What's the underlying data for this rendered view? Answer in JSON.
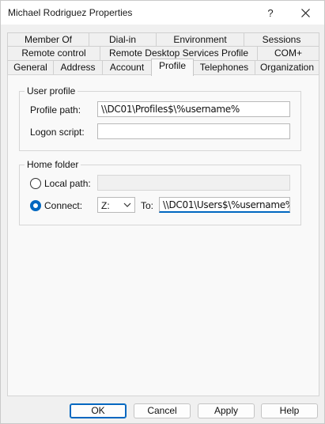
{
  "window": {
    "title": "Michael Rodriguez Properties",
    "help_label": "?",
    "close_label": "✕"
  },
  "tabs": {
    "row1": [
      "Member Of",
      "Dial-in",
      "Environment",
      "Sessions"
    ],
    "row2": [
      "Remote control",
      "Remote Desktop Services Profile",
      "COM+"
    ],
    "row3": [
      "General",
      "Address",
      "Account",
      "Profile",
      "Telephones",
      "Organization"
    ],
    "active": "Profile"
  },
  "user_profile": {
    "group_label": "User profile",
    "profile_path_label": "Profile path:",
    "profile_path_value": "\\\\DC01\\Profiles$\\%username%",
    "logon_script_label": "Logon script:",
    "logon_script_value": ""
  },
  "home_folder": {
    "group_label": "Home folder",
    "local_path_label": "Local path:",
    "local_path_value": "",
    "connect_label": "Connect:",
    "connect_selected": true,
    "drive_value": "Z:",
    "to_label": "To:",
    "to_value": "\\\\DC01\\Users$\\%username%"
  },
  "buttons": {
    "ok": "OK",
    "cancel": "Cancel",
    "apply": "Apply",
    "help": "Help"
  },
  "colors": {
    "accent": "#0067c0"
  }
}
